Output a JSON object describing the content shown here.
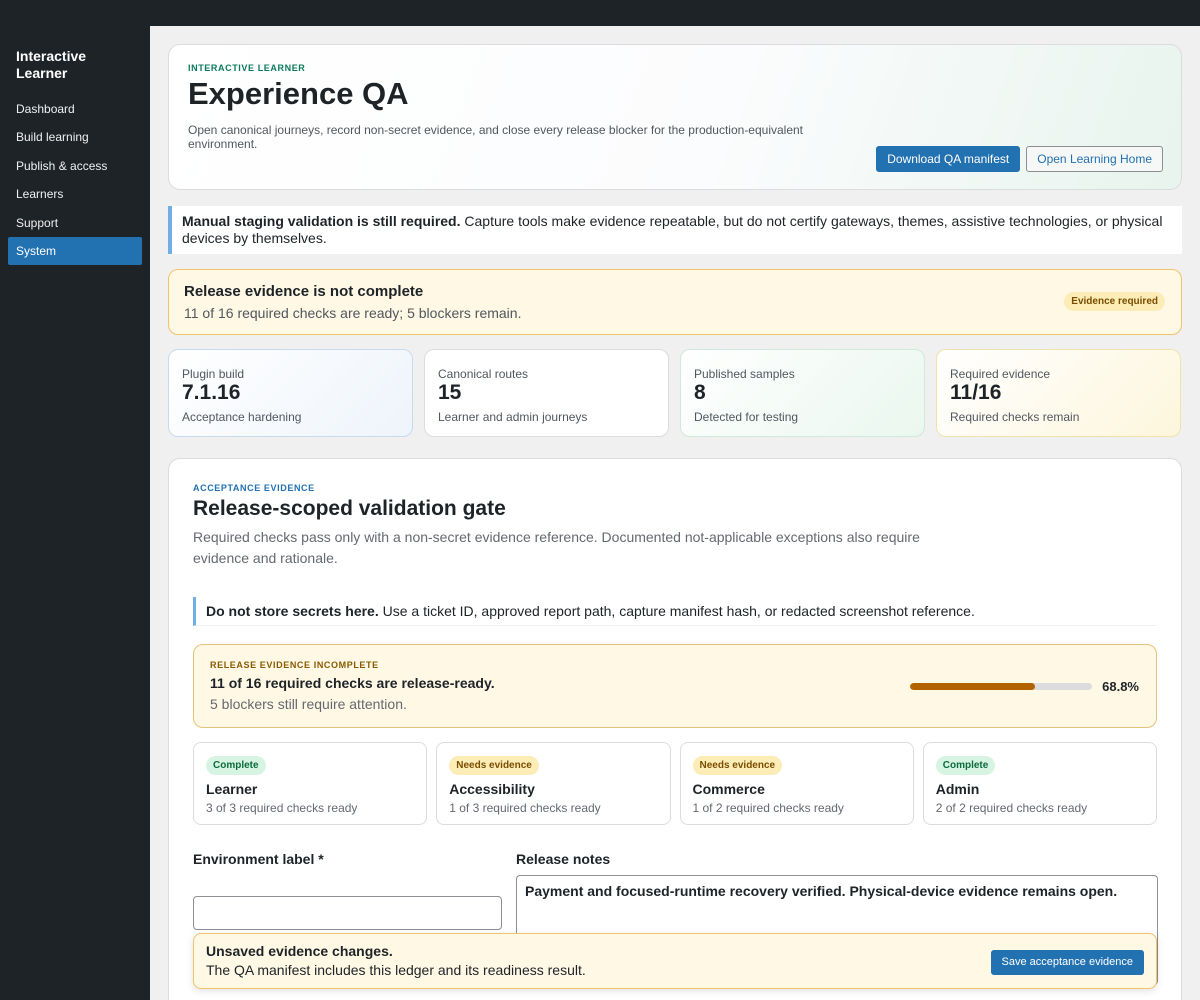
{
  "sidebar": {
    "brand": "Interactive Learner",
    "items": [
      {
        "label": "Dashboard"
      },
      {
        "label": "Build learning"
      },
      {
        "label": "Publish & access"
      },
      {
        "label": "Learners"
      },
      {
        "label": "Support"
      },
      {
        "label": "System",
        "active": true
      }
    ]
  },
  "hero": {
    "eyebrow": "Interactive Learner",
    "title": "Experience QA",
    "description": "Open canonical journeys, record non-secret evidence, and close every release blocker for the production-equivalent environment.",
    "download_label": "Download QA manifest",
    "open_label": "Open Learning Home"
  },
  "notice": {
    "strong": "Manual staging validation is still required.",
    "text": " Capture tools make evidence repeatable, but do not certify gateways, themes, assistive technologies, or physical devices by themselves."
  },
  "status": {
    "title": "Release evidence is not complete",
    "text": "11 of 16 required checks are ready; 5 blockers remain.",
    "badge": "Evidence required"
  },
  "metrics": [
    {
      "label": "Plugin build",
      "value": "7.1.16",
      "sub": "Acceptance hardening"
    },
    {
      "label": "Canonical routes",
      "value": "15",
      "sub": "Learner and admin journeys"
    },
    {
      "label": "Published samples",
      "value": "8",
      "sub": "Detected for testing"
    },
    {
      "label": "Required evidence",
      "value": "11/16",
      "sub": "Required checks remain"
    }
  ],
  "panel": {
    "eyebrow": "Acceptance evidence",
    "title": "Release-scoped validation gate",
    "description": "Required checks pass only with a non-secret evidence reference. Documented not-applicable exceptions also require evidence and rationale.",
    "callout_strong": "Do not store secrets here.",
    "callout_text": " Use a ticket ID, approved report path, capture manifest hash, or redacted screenshot reference."
  },
  "readiness": {
    "eyebrow": "Release evidence incomplete",
    "title": "11 of 16 required checks are release-ready.",
    "text": "5 blockers still require attention.",
    "percent_label": "68.8%",
    "percent": 68.8
  },
  "areas": [
    {
      "badge": "Complete",
      "status": "complete",
      "title": "Learner",
      "text": "3 of 3 required checks ready"
    },
    {
      "badge": "Needs evidence",
      "status": "needs",
      "title": "Accessibility",
      "text": "1 of 3 required checks ready"
    },
    {
      "badge": "Needs evidence",
      "status": "needs",
      "title": "Commerce",
      "text": "1 of 2 required checks ready"
    },
    {
      "badge": "Complete",
      "status": "complete",
      "title": "Admin",
      "text": "2 of 2 required checks ready"
    }
  ],
  "form": {
    "env_label": "Environment label *",
    "env_value": "",
    "notes_label": "Release notes",
    "notes_value": "Payment and focused-runtime recovery verified. Physical-device evidence remains open."
  },
  "unsaved": {
    "title": "Unsaved evidence changes.",
    "text": "The QA manifest includes this ledger and its readiness result.",
    "save_label": "Save acceptance evidence"
  },
  "colors": {
    "accent": "#2271b1",
    "sidebar_bg": "#1d2327",
    "warning_bg": "#fff8e5",
    "progress_fill": "#b26200"
  }
}
